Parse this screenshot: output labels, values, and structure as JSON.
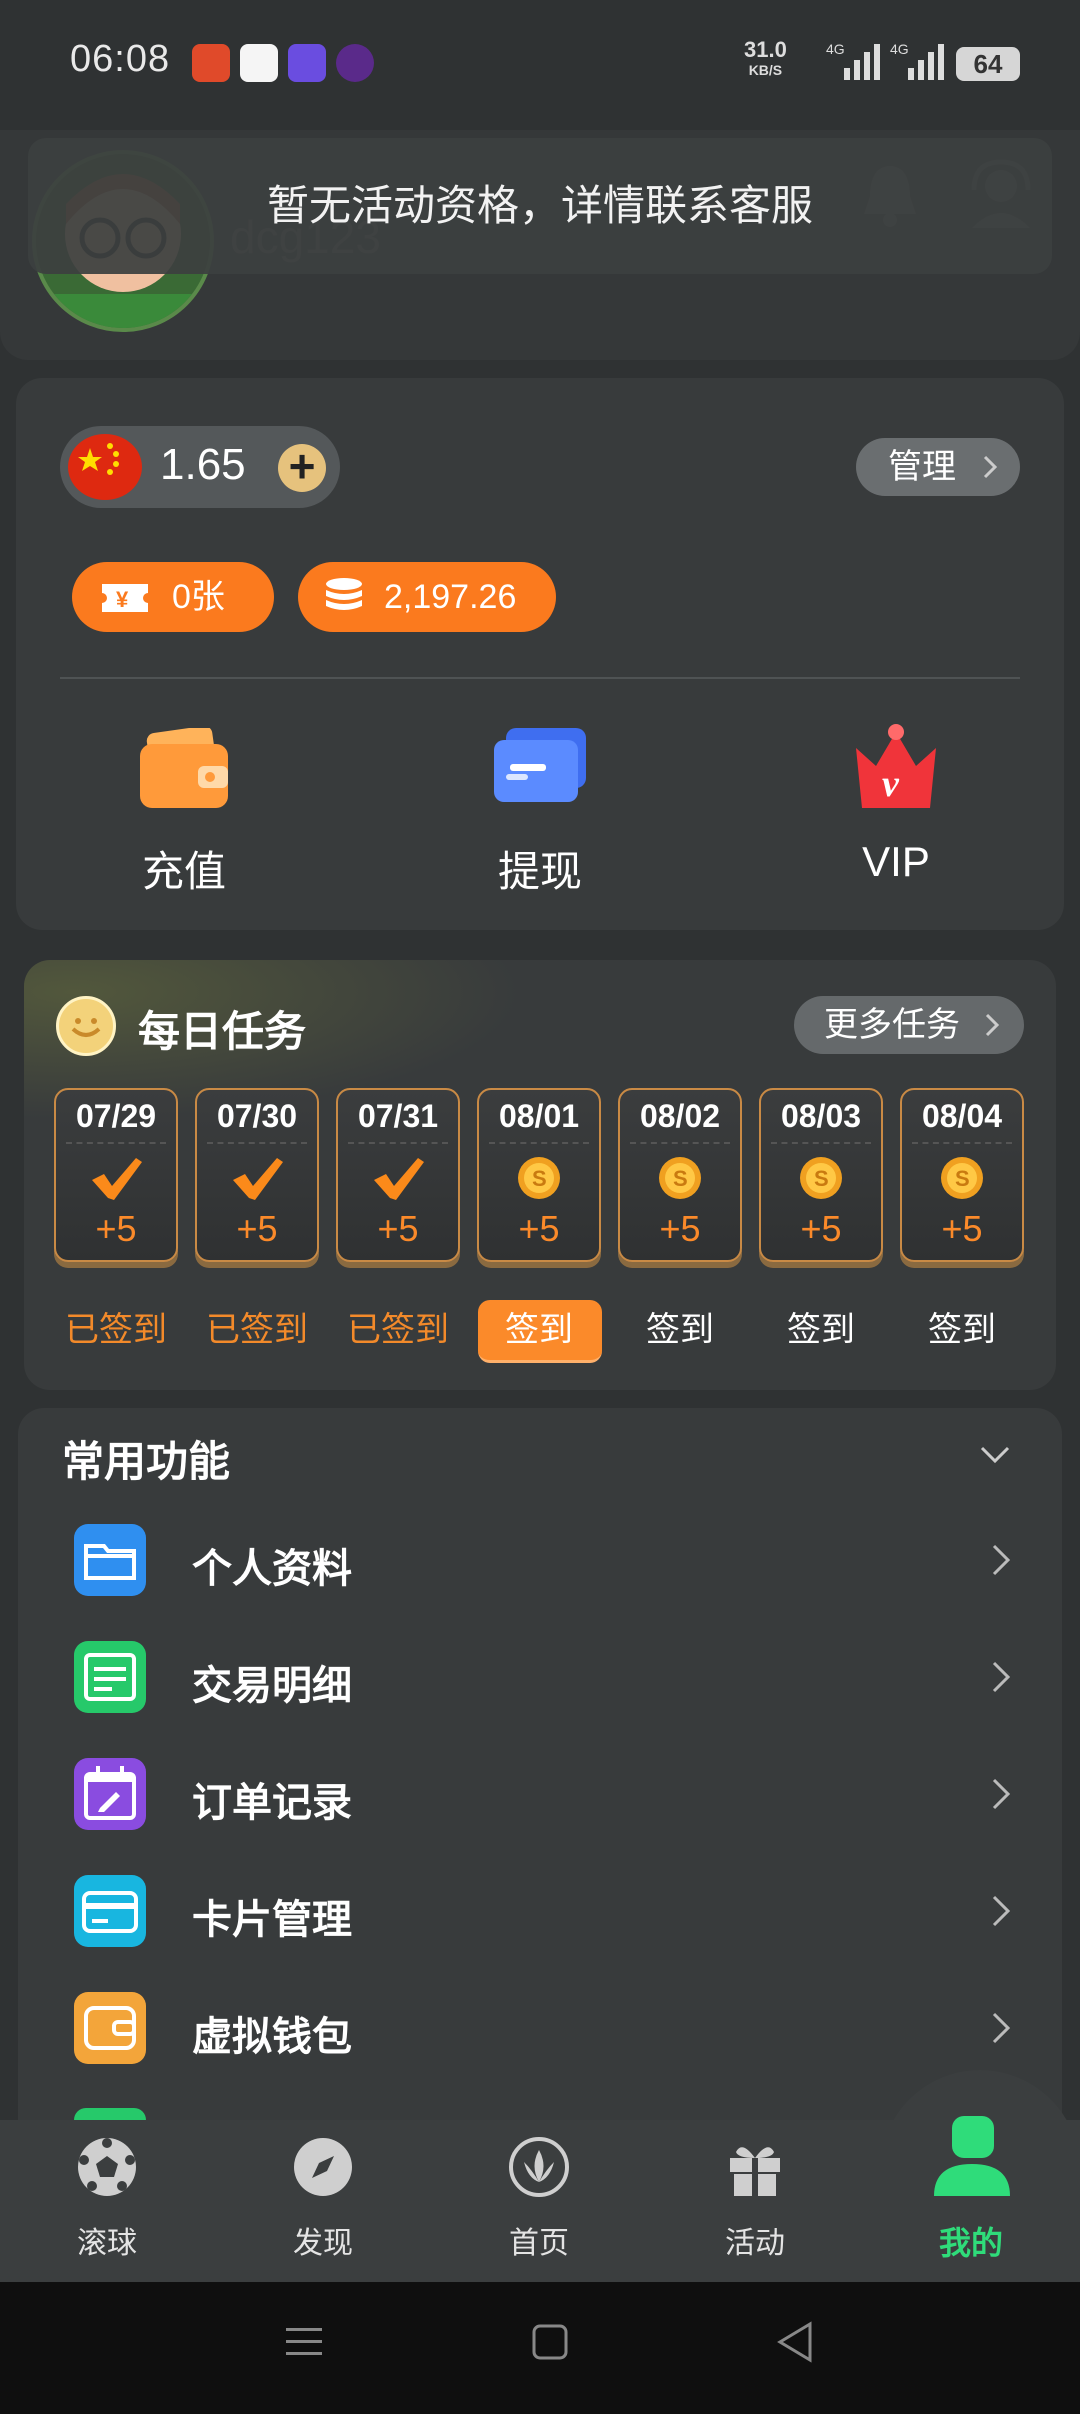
{
  "status_bar": {
    "time": "06:08",
    "net_speed": "31.0",
    "net_unit": "KB/S",
    "signal_1": "4G",
    "signal_2": "4G",
    "battery": "64"
  },
  "profile": {
    "username": "dcg123"
  },
  "toast": {
    "message": "暂无活动资格，详情联系客服"
  },
  "wallet": {
    "balance": "1.65",
    "manage_label": "管理",
    "tickets": "0张",
    "coins": "2,197.26",
    "actions": [
      {
        "label": "充值",
        "icon": "wallet-icon"
      },
      {
        "label": "提现",
        "icon": "card-withdraw-icon"
      },
      {
        "label": "VIP",
        "icon": "vip-crown-icon"
      }
    ]
  },
  "daily_tasks": {
    "title": "每日任务",
    "more_label": "更多任务",
    "days": [
      {
        "date": "07/29",
        "reward": "+5",
        "status": "已签到",
        "done": true
      },
      {
        "date": "07/30",
        "reward": "+5",
        "status": "已签到",
        "done": true
      },
      {
        "date": "07/31",
        "reward": "+5",
        "status": "已签到",
        "done": true
      },
      {
        "date": "08/01",
        "reward": "+5",
        "status": "签到",
        "done": false
      },
      {
        "date": "08/02",
        "reward": "+5",
        "status": "签到",
        "done": false
      },
      {
        "date": "08/03",
        "reward": "+5",
        "status": "签到",
        "done": false
      },
      {
        "date": "08/04",
        "reward": "+5",
        "status": "签到",
        "done": false
      }
    ]
  },
  "common_functions": {
    "title": "常用功能",
    "items": [
      {
        "label": "个人资料",
        "icon": "folder-icon",
        "color": "#2f8ff0"
      },
      {
        "label": "交易明细",
        "icon": "document-lines-icon",
        "color": "#26c96a"
      },
      {
        "label": "订单记录",
        "icon": "calendar-edit-icon",
        "color": "#8a4ce0"
      },
      {
        "label": "卡片管理",
        "icon": "credit-card-icon",
        "color": "#18b6e0"
      },
      {
        "label": "虚拟钱包",
        "icon": "wallet-outline-icon",
        "color": "#f3a53a"
      }
    ]
  },
  "bottom_nav": {
    "items": [
      {
        "label": "滚球",
        "icon": "soccer-ball-icon"
      },
      {
        "label": "发现",
        "icon": "compass-icon"
      },
      {
        "label": "首页",
        "icon": "home-logo-icon"
      },
      {
        "label": "活动",
        "icon": "gift-icon"
      },
      {
        "label": "我的",
        "icon": "person-icon",
        "active": true
      }
    ]
  },
  "colors": {
    "accent_orange": "#fb7a1e",
    "active_green": "#2fdc7a",
    "background": "#2f3233"
  }
}
